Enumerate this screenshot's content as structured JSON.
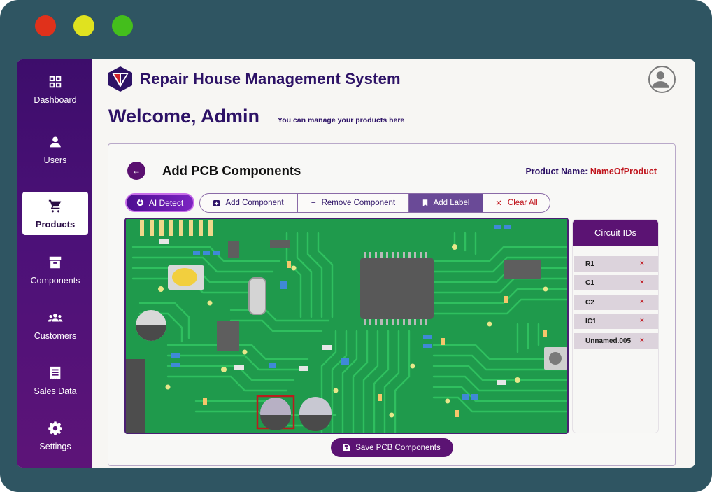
{
  "window": {
    "controls": [
      "close",
      "minimize",
      "maximize"
    ]
  },
  "app": {
    "title": "Repair House Management System"
  },
  "sidebar": {
    "items": [
      {
        "label": "Dashboard",
        "icon": "grid-icon",
        "active": false
      },
      {
        "label": "Users",
        "icon": "user-icon",
        "active": false
      },
      {
        "label": "Products",
        "icon": "cart-icon",
        "active": true
      },
      {
        "label": "Components",
        "icon": "archive-icon",
        "active": false
      },
      {
        "label": "Customers",
        "icon": "group-icon",
        "active": false
      },
      {
        "label": "Sales Data",
        "icon": "receipt-icon",
        "active": false
      },
      {
        "label": "Settings",
        "icon": "gear-icon",
        "active": false
      }
    ]
  },
  "header": {
    "welcome": "Welcome, Admin",
    "subtitle": "You can manage your products here"
  },
  "card": {
    "title": "Add PCB Components",
    "product_name_label": "Product Name:",
    "product_name_value": "NameOfProduct"
  },
  "toolbar": {
    "ai_detect": "AI Detect",
    "add_component": "Add Component",
    "remove_component": "Remove Component",
    "add_label": "Add Label",
    "clear_all": "Clear All",
    "active_tool": "Add Label"
  },
  "circuit_ids": {
    "header": "Circuit IDs",
    "items": [
      "R1",
      "C1",
      "C2",
      "IC1",
      "Unnamed.005"
    ],
    "remove_glyph": "×"
  },
  "save": {
    "label": "Save PCB Components"
  },
  "colors": {
    "frame": "#2f5562",
    "sidebar": "#4c1178",
    "accent": "#5b1373",
    "title": "#2d1266",
    "danger": "#c0151d",
    "pcb": "#1e9a4b"
  }
}
